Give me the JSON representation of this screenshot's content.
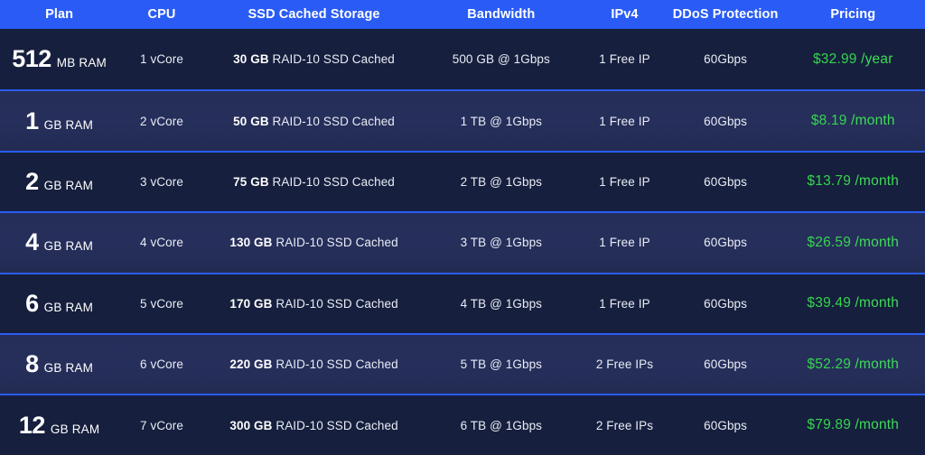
{
  "colors": {
    "header_bg": "#2a5cf5",
    "row_dark_bg": "#161f3d",
    "row_light_bg": "#252e58",
    "divider": "#2a5cf5",
    "price_green": "#35d44e",
    "text_white": "#ffffff",
    "text_muted": "#e9ecf5"
  },
  "header": {
    "columns": [
      {
        "label": "Plan"
      },
      {
        "label": "CPU"
      },
      {
        "label": "SSD Cached Storage"
      },
      {
        "label": "Bandwidth"
      },
      {
        "label": "IPv4"
      },
      {
        "label": "DDoS Protection"
      },
      {
        "label": "Pricing"
      }
    ]
  },
  "rows": [
    {
      "plan_size": "512",
      "plan_unit": "MB RAM",
      "cpu": "1 vCore",
      "storage_amount": "30 GB",
      "storage_desc": "RAID-10 SSD Cached",
      "bandwidth": "500 GB @ 1Gbps",
      "ipv4": "1 Free IP",
      "ddos": "60Gbps",
      "price_amount": "$32.99",
      "price_period": "/year"
    },
    {
      "plan_size": "1",
      "plan_unit": "GB RAM",
      "cpu": "2 vCore",
      "storage_amount": "50 GB",
      "storage_desc": "RAID-10 SSD Cached",
      "bandwidth": "1 TB @ 1Gbps",
      "ipv4": "1 Free IP",
      "ddos": "60Gbps",
      "price_amount": "$8.19",
      "price_period": "/month"
    },
    {
      "plan_size": "2",
      "plan_unit": "GB RAM",
      "cpu": "3 vCore",
      "storage_amount": "75 GB",
      "storage_desc": "RAID-10 SSD Cached",
      "bandwidth": "2 TB @ 1Gbps",
      "ipv4": "1 Free IP",
      "ddos": "60Gbps",
      "price_amount": "$13.79",
      "price_period": "/month"
    },
    {
      "plan_size": "4",
      "plan_unit": "GB RAM",
      "cpu": "4 vCore",
      "storage_amount": "130 GB",
      "storage_desc": "RAID-10 SSD Cached",
      "bandwidth": "3 TB @ 1Gbps",
      "ipv4": "1 Free IP",
      "ddos": "60Gbps",
      "price_amount": "$26.59",
      "price_period": "/month"
    },
    {
      "plan_size": "6",
      "plan_unit": "GB RAM",
      "cpu": "5 vCore",
      "storage_amount": "170 GB",
      "storage_desc": "RAID-10 SSD Cached",
      "bandwidth": "4 TB @ 1Gbps",
      "ipv4": "1 Free IP",
      "ddos": "60Gbps",
      "price_amount": "$39.49",
      "price_period": "/month"
    },
    {
      "plan_size": "8",
      "plan_unit": "GB RAM",
      "cpu": "6 vCore",
      "storage_amount": "220 GB",
      "storage_desc": "RAID-10 SSD Cached",
      "bandwidth": "5 TB @ 1Gbps",
      "ipv4": "2 Free IPs",
      "ddos": "60Gbps",
      "price_amount": "$52.29",
      "price_period": "/month"
    },
    {
      "plan_size": "12",
      "plan_unit": "GB RAM",
      "cpu": "7 vCore",
      "storage_amount": "300 GB",
      "storage_desc": "RAID-10 SSD Cached",
      "bandwidth": "6 TB @ 1Gbps",
      "ipv4": "2 Free IPs",
      "ddos": "60Gbps",
      "price_amount": "$79.89",
      "price_period": "/month"
    }
  ]
}
